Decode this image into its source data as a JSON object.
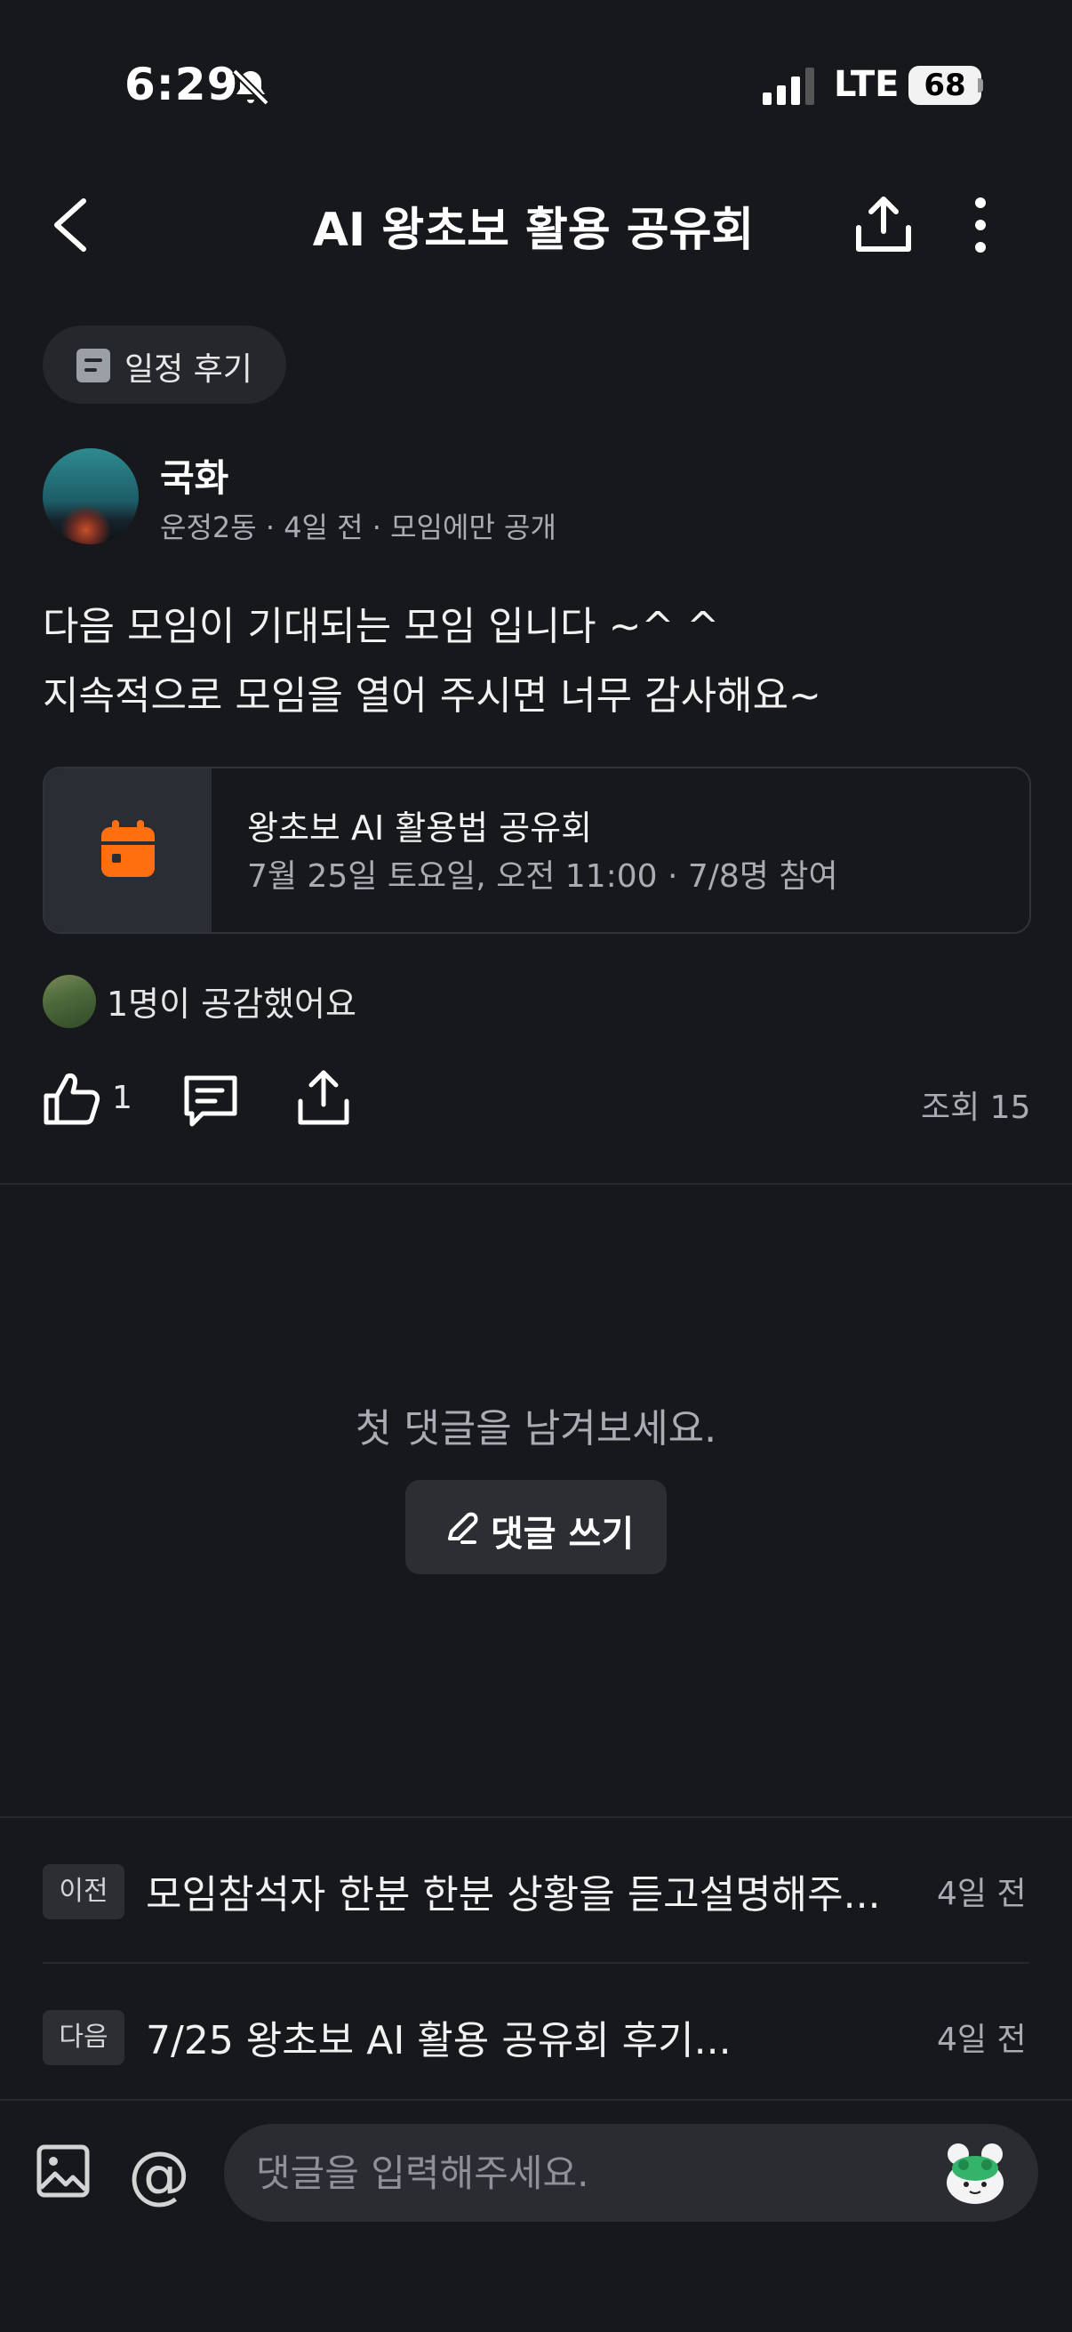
{
  "status_bar": {
    "time": "6:29",
    "network": "LTE",
    "battery": "68"
  },
  "header": {
    "title": "AI 왕초보 활용 공유회"
  },
  "post": {
    "category": "일정 후기",
    "author": {
      "name": "국화",
      "meta": "운정2동 · 4일 전 · 모임에만 공개"
    },
    "body": [
      "다음 모임이 기대되는 모임 입니다 ~^ ^",
      "지속적으로 모임을 열어 주시면 너무 감사해요~"
    ],
    "event": {
      "title": "왕초보 AI 활용법 공유회",
      "details": "7월 25일 토요일, 오전 11:00 · 7/8명 참여",
      "icon_color": "#ff6f0f"
    },
    "likers_text": "1명이 공감했어요",
    "like_count": "1",
    "views": "조회 15"
  },
  "comments": {
    "empty_text": "첫 댓글을 남겨보세요.",
    "write_label": "댓글 쓰기"
  },
  "navigation": {
    "prev": {
      "badge": "이전",
      "title": "모임참석자 한분 한분 상황을 듣고설명해주...",
      "time": "4일 전"
    },
    "next": {
      "badge": "다음",
      "title": "7/25 왕초보 AI 활용 공유회 후기...",
      "time": "4일 전"
    }
  },
  "input_bar": {
    "placeholder": "댓글을 입력해주세요.",
    "at_symbol": "@"
  },
  "colors": {
    "background": "#17181c",
    "accent": "#ff6f0f"
  }
}
